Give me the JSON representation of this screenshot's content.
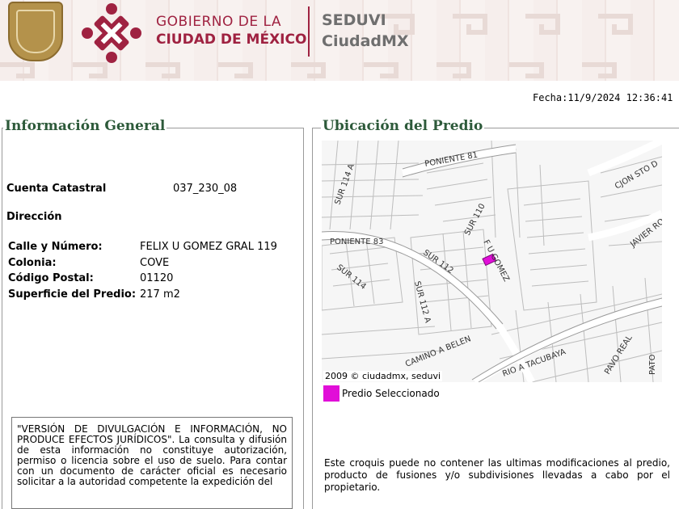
{
  "header": {
    "gov_line1": "GOBIERNO DE LA",
    "gov_line2": "CIUDAD DE MÉXICO",
    "sec_line1": "SEDUVI",
    "sec_line2": "CiudadMX",
    "brand_color": "#9f2241"
  },
  "fecha": "Fecha:11/9/2024 12:36:41 PM",
  "info": {
    "legend": "Información General",
    "cuenta_label": "Cuenta Catastral",
    "cuenta_value": "037_230_08",
    "direccion_label": "Dirección",
    "calle_label": "Calle y Número:",
    "calle_value": "FELIX U GOMEZ GRAL 119",
    "colonia_label": "Colonia:",
    "colonia_value": "COVE",
    "cp_label": "Código Postal:",
    "cp_value": "01120",
    "superficie_label": "Superficie del Predio:",
    "superficie_value": "217 m2",
    "disclaimer": "\"VERSIÓN DE DIVULGACIÓN E INFORMACIÓN, NO PRODUCE EFECTOS JURÍDICOS\". La consulta y difusión de esta información no constituye autorización, permiso o licencia sobre el uso de suelo. Para contar con un documento de carácter oficial es necesario solicitar a la autoridad competente la expedición del"
  },
  "ubicacion": {
    "legend": "Ubicación del Predio",
    "map_copyright": "2009 © ciudadmx, seduvi",
    "selected_label": "Predio Seleccionado",
    "selected_color": "#e10ed8",
    "street_labels": [
      "PONIENTE 81",
      "SUR 114 A",
      "SUR 110",
      "CJON STO D",
      "JAVIER RO",
      "PONIENTE 83",
      "SUR 112",
      "F U GOMEZ",
      "SUR 114",
      "SUR 112 A",
      "CAMINO A BELEN",
      "RIO A TACUBAYA",
      "PAVO REAL",
      "PATO"
    ],
    "note": "Este croquis puede no contener las ultimas modificaciones al predio, producto de fusiones y/o subdivisiones llevadas a cabo por el propietario."
  }
}
